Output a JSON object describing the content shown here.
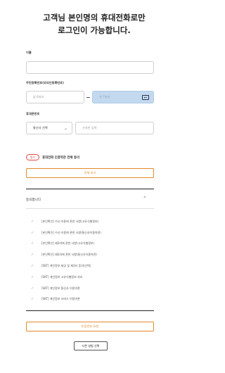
{
  "title": {
    "line1": "고객님 본인명의 휴대전화로만",
    "line2": "로그인이 가능합니다."
  },
  "name_field": {
    "label": "이름",
    "placeholder": ""
  },
  "rrn": {
    "label": "주민등록번호(외국인등록번호)",
    "front_placeholder": "앞 6자리",
    "back_placeholder": "뒤 7자리"
  },
  "phone": {
    "label": "휴대폰번호",
    "carrier_selected": "통신사 선택",
    "number_placeholder": "숫자만 입력"
  },
  "consent": {
    "badge": "필수",
    "text": "휴대전화 인증약관 전체 동의",
    "view_all_button": "전체 보기"
  },
  "terms": {
    "agree_all_label": "동의합니다",
    "items": [
      "[본인확인] 수신·이용에 관한 사항(고유식별정보)",
      "[본인확인] 수신·이용에 관한 사항(통신사이용약관)",
      "[본인확인] 제3자에 관한 사항(고유식별정보)",
      "[본인확인] 제3자에 관한 사항(통신사이용약관)",
      "[SKT] 개인정보 제공 및 제3자 동의(선택)",
      "[SKT] 개인정보 고유식별정보 처리",
      "[SKT] 개인정보 통신사 이용약관",
      "[SKT] 개인정보 서비스 이용약관"
    ]
  },
  "request_button": "인증번호 요청",
  "bottom_button": "다른 방법 선택",
  "colors": {
    "accent": "#e38a2a",
    "required": "#e24a4a",
    "highlight": "#c2d9f0"
  }
}
